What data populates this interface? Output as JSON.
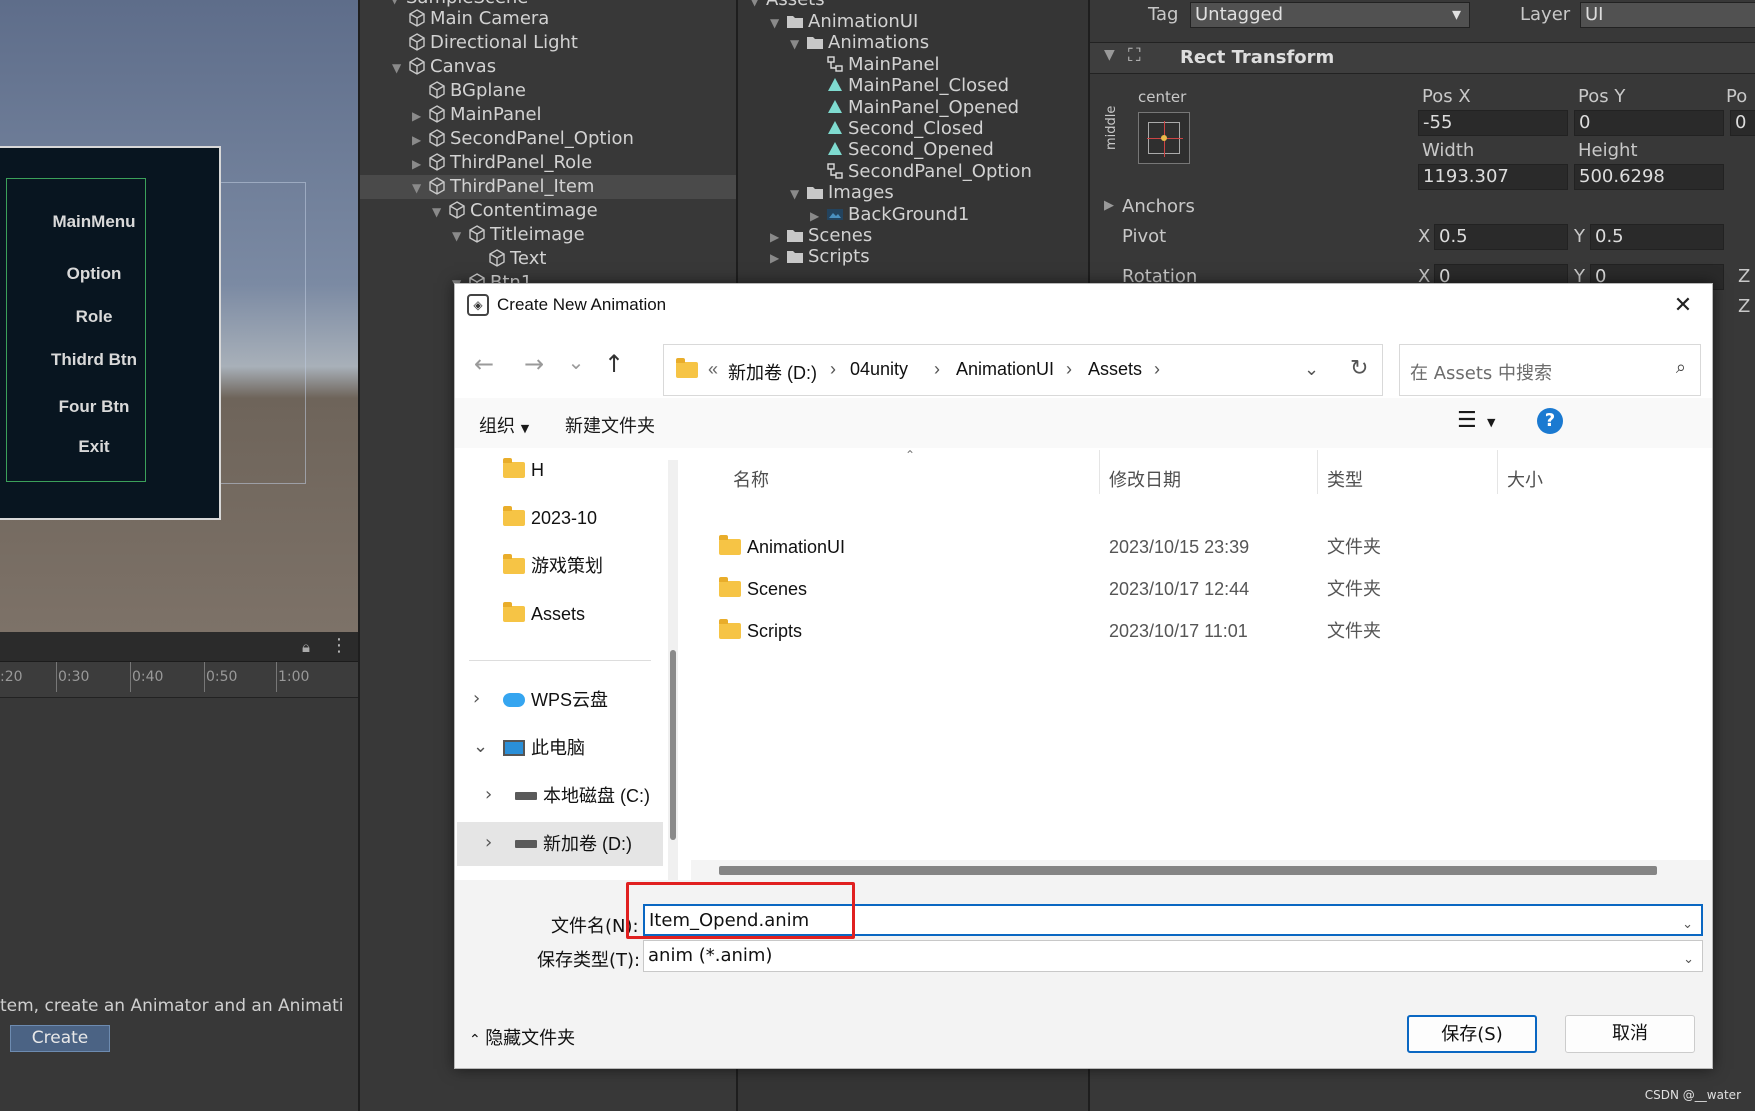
{
  "scene": {
    "menu_items": [
      "MainMenu",
      "Option",
      "Role",
      "Thidrd Btn",
      "Four Btn",
      "Exit"
    ]
  },
  "timeline": {
    "ticks": [
      ":20",
      "0:30",
      "0:40",
      "0:50",
      "1:00"
    ],
    "message": "tem, create an Animator and an Animati",
    "create_label": "Create"
  },
  "hierarchy": {
    "top_partial": "SampleScene",
    "items": [
      {
        "label": "Main Camera",
        "indent": 1,
        "arrow": ""
      },
      {
        "label": "Directional Light",
        "indent": 1,
        "arrow": ""
      },
      {
        "label": "Canvas",
        "indent": 1,
        "arrow": "▼"
      },
      {
        "label": "BGplane",
        "indent": 2,
        "arrow": ""
      },
      {
        "label": "MainPanel",
        "indent": 2,
        "arrow": "▶"
      },
      {
        "label": "SecondPanel_Option",
        "indent": 2,
        "arrow": "▶"
      },
      {
        "label": "ThirdPanel_Role",
        "indent": 2,
        "arrow": "▶"
      },
      {
        "label": "ThirdPanel_Item",
        "indent": 2,
        "arrow": "▼",
        "selected": true
      },
      {
        "label": "Contentimage",
        "indent": 3,
        "arrow": "▼"
      },
      {
        "label": "Titleimage",
        "indent": 4,
        "arrow": "▼"
      },
      {
        "label": "Text",
        "indent": 5,
        "arrow": ""
      },
      {
        "label": "Btn1",
        "indent": 4,
        "arrow": "▼"
      }
    ]
  },
  "project": {
    "top_partial": "Assets",
    "items": [
      {
        "label": "AnimationUI",
        "indent": 1,
        "arrow": "▼",
        "kind": "folder"
      },
      {
        "label": "Animations",
        "indent": 2,
        "arrow": "▼",
        "kind": "folder"
      },
      {
        "label": "MainPanel",
        "indent": 3,
        "arrow": "",
        "kind": "controller"
      },
      {
        "label": "MainPanel_Closed",
        "indent": 3,
        "arrow": "",
        "kind": "anim"
      },
      {
        "label": "MainPanel_Opened",
        "indent": 3,
        "arrow": "",
        "kind": "anim"
      },
      {
        "label": "Second_Closed",
        "indent": 3,
        "arrow": "",
        "kind": "anim"
      },
      {
        "label": "Second_Opened",
        "indent": 3,
        "arrow": "",
        "kind": "anim"
      },
      {
        "label": "SecondPanel_Option",
        "indent": 3,
        "arrow": "",
        "kind": "controller"
      },
      {
        "label": "Images",
        "indent": 2,
        "arrow": "▼",
        "kind": "folder"
      },
      {
        "label": "BackGround1",
        "indent": 3,
        "arrow": "▶",
        "kind": "image"
      },
      {
        "label": "Scenes",
        "indent": 1,
        "arrow": "▶",
        "kind": "folder"
      },
      {
        "label": "Scripts",
        "indent": 1,
        "arrow": "▶",
        "kind": "folder"
      }
    ]
  },
  "inspector": {
    "tag_label": "Tag",
    "tag_value": "Untagged",
    "layer_label": "Layer",
    "layer_value": "UI",
    "component_title": "Rect Transform",
    "anchor_h": "center",
    "anchor_v": "middle",
    "posx_label": "Pos X",
    "posy_label": "Pos Y",
    "posz_label": "Po",
    "posx": "-55",
    "posy": "0",
    "posz": "0",
    "width_label": "Width",
    "height_label": "Height",
    "width": "1193.307",
    "height": "500.6298",
    "anchors_label": "Anchors",
    "pivot_label": "Pivot",
    "pivot_x_label": "X",
    "pivot_x": "0.5",
    "pivot_y_label": "Y",
    "pivot_y": "0.5",
    "rotation_label": "Rotation",
    "rot_x": "0",
    "rot_y": "0",
    "z_label": "Z"
  },
  "dialog": {
    "title": "Create New Animation",
    "close_glyph": "✕",
    "nav": {
      "back": "←",
      "forward": "→",
      "recent": "⌄",
      "up": "↑"
    },
    "address": {
      "chevrons": "«",
      "crumbs": [
        "新加卷 (D:)",
        "04unity",
        "AnimationUI",
        "Assets"
      ],
      "refresh": "↻"
    },
    "search_placeholder": "在 Assets 中搜索",
    "toolbar": {
      "organize": "组织",
      "new_folder": "新建文件夹",
      "help": "?"
    },
    "nav_pane": [
      {
        "label": "H",
        "kind": "folder"
      },
      {
        "label": "2023-10",
        "kind": "folder"
      },
      {
        "label": "游戏策划",
        "kind": "folder"
      },
      {
        "label": "Assets",
        "kind": "folder"
      },
      {
        "label": "WPS云盘",
        "kind": "cloud",
        "expander": "›"
      },
      {
        "label": "此电脑",
        "kind": "pc",
        "expander": "⌄"
      },
      {
        "label": "本地磁盘 (C:)",
        "kind": "drive",
        "expander": "›"
      },
      {
        "label": "新加卷 (D:)",
        "kind": "drive",
        "expander": "›",
        "selected": true
      }
    ],
    "columns": [
      "名称",
      "修改日期",
      "类型",
      "大小"
    ],
    "files": [
      {
        "name": "AnimationUI",
        "date": "2023/10/15 23:39",
        "type": "文件夹"
      },
      {
        "name": "Scenes",
        "date": "2023/10/17 12:44",
        "type": "文件夹"
      },
      {
        "name": "Scripts",
        "date": "2023/10/17 11:01",
        "type": "文件夹"
      }
    ],
    "filename_label": "文件名(N):",
    "filename_value": "Item_Opend.anim",
    "filetype_label": "保存类型(T):",
    "filetype_value": "anim (*.anim)",
    "hide_folders": "隐藏文件夹",
    "save_label": "保存(S)",
    "cancel_label": "取消"
  },
  "watermark": "CSDN @__water",
  "colors": {
    "accent": "#0a67c2",
    "highlight": "#e02020",
    "unity_bg": "#383838"
  }
}
